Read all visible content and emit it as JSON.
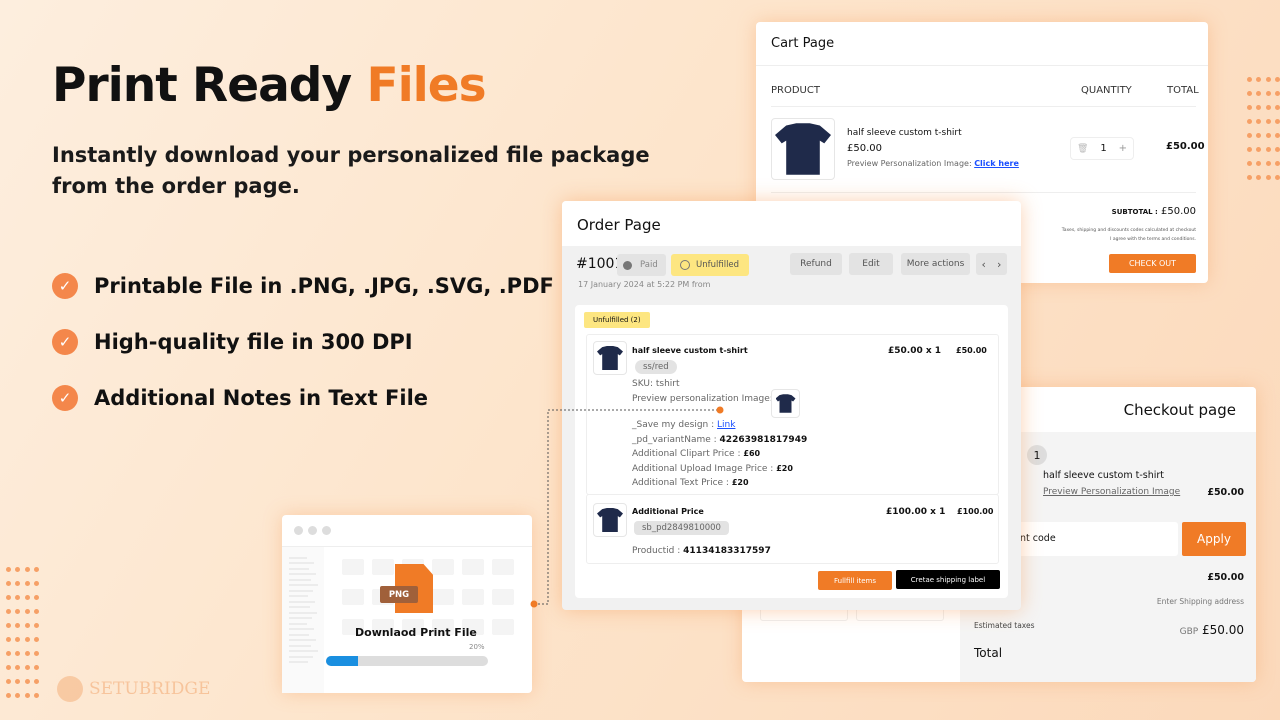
{
  "hero": {
    "title_main": "Print Ready",
    "title_accent": "Files",
    "subtitle": "Instantly download your personalized file package from the order page.",
    "features": [
      "Printable File in .PNG, .JPG, .SVG, .PDF",
      "High-quality file in 300 DPI",
      "Additional Notes in Text File"
    ],
    "check_icon": "✓"
  },
  "brand": {
    "name": "SETUBRIDGE"
  },
  "colors": {
    "accent": "#f07b26",
    "link": "#1a4fff",
    "progress": "#1a8fe0",
    "unfulfilled": "#fde681"
  },
  "cart": {
    "title": "Cart Page",
    "col_product": "PRODUCT",
    "col_quantity": "QUANTITY",
    "col_total": "TOTAL",
    "item": {
      "name": "half sleeve custom t-shirt",
      "price": "£50.00",
      "preview_label": "Preview Personalization Image:",
      "preview_link": "Click here",
      "quantity": "1",
      "total": "£50.00"
    },
    "subtotal_label": "SUBTOTAL :",
    "subtotal": "£50.00",
    "note1": "Taxes, shipping and discounts codes calculated at checkout",
    "note2": "I agree with the terms and conditions.",
    "checkout_button": "CHECK OUT"
  },
  "order": {
    "title": "Order Page",
    "number": "#1001",
    "paid": "Paid",
    "unfulfilled": "Unfulfilled",
    "refund": "Refund",
    "edit": "Edit",
    "more_actions": "More actions",
    "date": "17 January 2024 at 5:22 PM from",
    "section_badge": "Unfulfilled (2)",
    "item1": {
      "name": "half sleeve custom t-shirt",
      "variant": "ss/red",
      "price_qty": "£50.00 x 1",
      "total": "£50.00",
      "sku": "SKU: tshirt",
      "preview_label": "Preview personalization Image:",
      "save_label": "_Save my design :",
      "save_link": "Link",
      "variant_label": "_pd_variantName :",
      "variant_value": "42263981817949",
      "clipart_label": "Additional Clipart Price :",
      "clipart_value": "£60",
      "upload_label": "Additional Upload Image Price :",
      "upload_value": "£20",
      "text_label": "Additional Text Price :",
      "text_value": "£20"
    },
    "item2": {
      "name": "Additional Price",
      "variant": "sb_pd2849810000",
      "price_qty": "£100.00 x 1",
      "total": "£100.00",
      "productid_label": "Productid :",
      "productid_value": "41134183317597"
    },
    "fulfill_button": "Fullfill items",
    "shipping_button": "Cretae shipping label"
  },
  "checkout": {
    "title": "Checkout page",
    "qty_badge": "1",
    "item_name": "half sleeve custom t-shirt",
    "preview_link": "Preview Personalization Image",
    "item_price": "£50.00",
    "discount_placeholder": "nt code",
    "apply": "Apply",
    "subtotal": "£50.00",
    "shipping": "Enter Shipping address",
    "taxes_label": "Estimated taxes",
    "currency": "GBP",
    "total_value": "£50.00",
    "total_label": "Total"
  },
  "download": {
    "file_type": "PNG",
    "label": "Downlaod Print File",
    "progress_text": "20%",
    "progress": 0.2
  }
}
